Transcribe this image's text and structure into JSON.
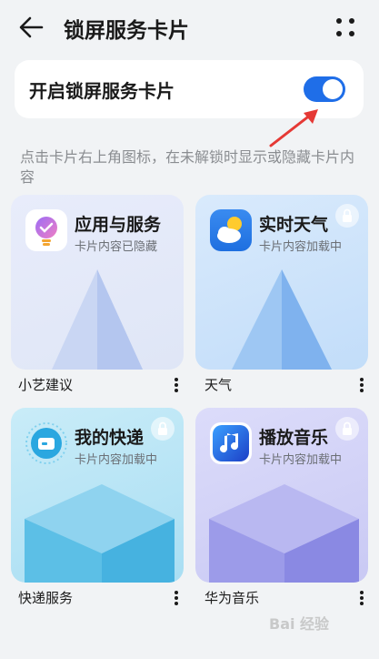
{
  "header": {
    "title": "锁屏服务卡片"
  },
  "toggle": {
    "label": "开启锁屏服务卡片",
    "on": true
  },
  "description": "点击卡片右上角图标，在未解锁时显示或隐藏卡片内容",
  "cards": [
    {
      "title": "应用与服务",
      "status": "卡片内容已隐藏",
      "caption": "小艺建议",
      "icon": "xiaoyi-suggestion-icon",
      "locked": false
    },
    {
      "title": "实时天气",
      "status": "卡片内容加载中",
      "caption": "天气",
      "icon": "weather-icon",
      "locked": true
    },
    {
      "title": "我的快递",
      "status": "卡片内容加载中",
      "caption": "快递服务",
      "icon": "package-icon",
      "locked": true
    },
    {
      "title": "播放音乐",
      "status": "卡片内容加载中",
      "caption": "华为音乐",
      "icon": "music-icon",
      "locked": true
    }
  ],
  "watermark": "Bai 经验",
  "colors": {
    "accent": "#1f6ee8",
    "annotation_arrow": "#e53935"
  }
}
